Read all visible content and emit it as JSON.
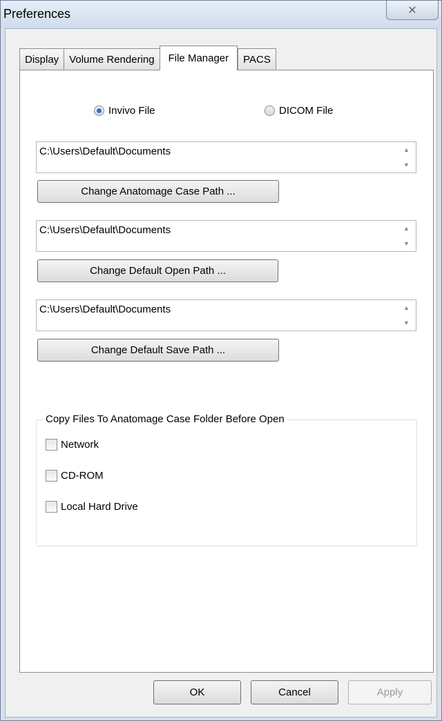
{
  "window": {
    "title": "Preferences",
    "close_glyph": "✕"
  },
  "tabs": [
    {
      "label": "Display"
    },
    {
      "label": "Volume Rendering"
    },
    {
      "label": "File Manager"
    },
    {
      "label": "PACS"
    }
  ],
  "active_tab": "File Manager",
  "file_type": {
    "options": [
      {
        "label": "Invivo File",
        "selected": true
      },
      {
        "label": "DICOM File",
        "selected": false
      }
    ]
  },
  "paths": {
    "case_path": "C:\\Users\\Default\\Documents",
    "open_path": "C:\\Users\\Default\\Documents",
    "save_path": "C:\\Users\\Default\\Documents"
  },
  "buttons": {
    "change_case": "Change Anatomage Case Path ...",
    "change_open": "Change Default Open Path ...",
    "change_save": "Change Default Save Path ..."
  },
  "copy_group": {
    "legend": "Copy Files To Anatomage Case Folder Before Open",
    "items": [
      {
        "label": "Network",
        "checked": false
      },
      {
        "label": "CD-ROM",
        "checked": false
      },
      {
        "label": "Local Hard Drive",
        "checked": false
      }
    ]
  },
  "footer": {
    "ok": "OK",
    "cancel": "Cancel",
    "apply": "Apply",
    "apply_enabled": false
  },
  "icons": {
    "scroll_up": "▲",
    "scroll_down": "▼"
  }
}
